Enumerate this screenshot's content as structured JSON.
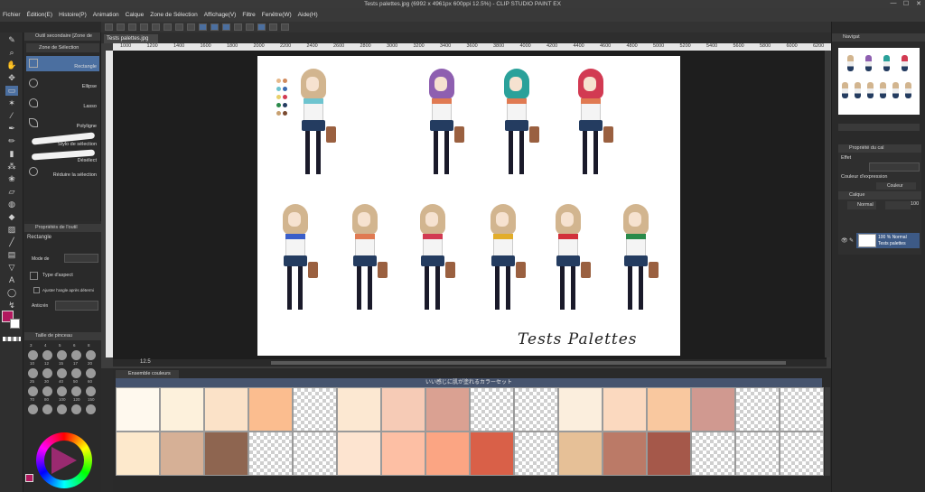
{
  "window": {
    "title": "Tests palettes.jpg (6992 x 4961px 600ppi 12.5%) - CLIP STUDIO PAINT EX",
    "minimize": "—",
    "maximize": "☐",
    "close": "✕"
  },
  "menu": [
    "Fichier",
    "Édition(E)",
    "Histoire(P)",
    "Animation",
    "Calque",
    "Zone de Sélection",
    "Affichage(V)",
    "Filtre",
    "Fenêtre(W)",
    "Aide(H)"
  ],
  "subtool": {
    "header": "Outil secondaire [Zone de",
    "group": "Zone de Sélection",
    "items": [
      {
        "label": "Rectangle",
        "active": true
      },
      {
        "label": "Ellipse",
        "active": false
      },
      {
        "label": "Lasso",
        "active": false
      },
      {
        "label": "Polyligne",
        "active": false
      },
      {
        "label": "Stylo de sélection",
        "active": false
      },
      {
        "label": "Désélect",
        "active": false
      },
      {
        "label": "Réduire la sélection",
        "active": false
      }
    ]
  },
  "toolprop": {
    "header": "Propriétés de l'outil",
    "name": "Rectangle",
    "mode_label": "Mode de",
    "aspect_label": "Type d'aspect",
    "angle_label": "Ajuster l'angle après détermi",
    "anti_label": "Anticrén"
  },
  "brushsize": {
    "header": "Taille de pinceau",
    "sizes": [
      "3",
      "4",
      "5",
      "6",
      "8",
      "10",
      "12",
      "15",
      "17",
      "20",
      "25",
      "30",
      "40",
      "50",
      "60",
      "70",
      "80",
      "100",
      "120",
      "150"
    ]
  },
  "document": {
    "tab": "Tests palettes.jpg",
    "title": "Tests Palettes",
    "zoom": "12.5"
  },
  "ruler": [
    "1000",
    "1200",
    "1400",
    "1600",
    "1800",
    "2000",
    "2200",
    "2400",
    "2600",
    "2800",
    "3000",
    "3200",
    "3400",
    "3600",
    "3800",
    "4000",
    "4200",
    "4400",
    "4600",
    "4800",
    "5000",
    "5200",
    "5400",
    "5600",
    "5800",
    "6000",
    "6200"
  ],
  "colorset": {
    "tab": "Ensemble couleurs",
    "name": "いい感じに肌が塗れるカラーセット",
    "rows": [
      [
        "#fff9ee",
        "#fdf1dc",
        "#fbe2c8",
        "#fbbd8f",
        null,
        "#fce8d2",
        "#f6cbb6",
        "#daa192",
        null,
        null,
        "#fbeedd",
        "#fbd9bf",
        "#f9c89f",
        "#d09990",
        null,
        null
      ],
      [
        "#fde9cc",
        "#d6b096",
        "#8e6550",
        null,
        null,
        "#fde4d0",
        "#fdbfa4",
        "#fba583",
        "#d96048",
        null,
        "#e6c097",
        "#bb7a67",
        "#a5584a",
        null,
        null,
        null
      ]
    ]
  },
  "navigator": {
    "header": "Navigat"
  },
  "properties": {
    "header": "Propriété du cal",
    "effect": "Effet",
    "expression_label": "Couleur d'expression",
    "expression_value": "Couleur"
  },
  "layers": {
    "header": "Calque",
    "blend": "Normal",
    "opacity": "100",
    "layer_line1": "100 % Normal",
    "layer_line2": "Tests palettes"
  },
  "colors": {
    "main": "#b2195f",
    "accent": "#4b6fa0"
  }
}
